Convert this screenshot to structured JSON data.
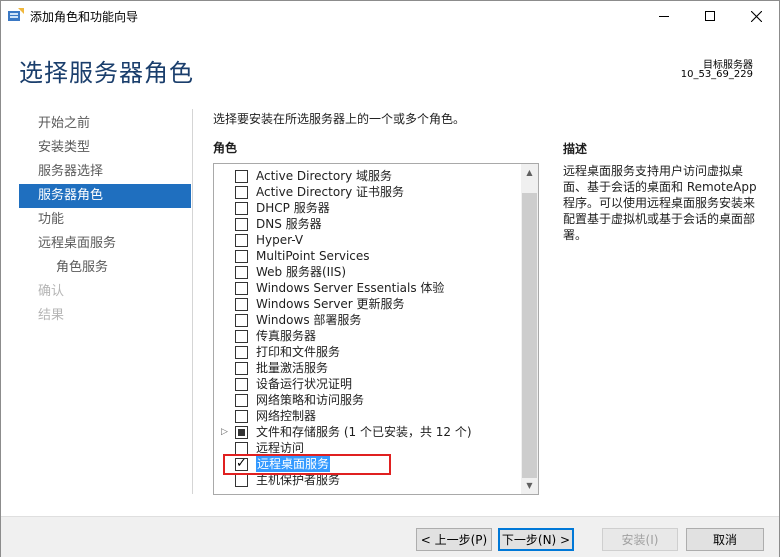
{
  "window": {
    "title": "添加角色和功能向导",
    "minimize_icon": "minimize-icon",
    "maximize_icon": "maximize-icon",
    "close_icon": "close-icon"
  },
  "header": {
    "page_title": "选择服务器角色",
    "target_label": "目标服务器",
    "target_value": "10_53_69_229"
  },
  "sidebar": {
    "items": [
      {
        "label": "开始之前",
        "state": "normal"
      },
      {
        "label": "安装类型",
        "state": "normal"
      },
      {
        "label": "服务器选择",
        "state": "normal"
      },
      {
        "label": "服务器角色",
        "state": "active"
      },
      {
        "label": "功能",
        "state": "normal"
      },
      {
        "label": "远程桌面服务",
        "state": "normal"
      },
      {
        "label": "角色服务",
        "state": "sub"
      },
      {
        "label": "确认",
        "state": "disabled"
      },
      {
        "label": "结果",
        "state": "disabled"
      }
    ]
  },
  "main": {
    "instruction": "选择要安装在所选服务器上的一个或多个角色。",
    "roles_heading": "角色",
    "roles": [
      {
        "label": "Active Directory 域服务",
        "checked": false
      },
      {
        "label": "Active Directory 证书服务",
        "checked": false
      },
      {
        "label": "DHCP 服务器",
        "checked": false
      },
      {
        "label": "DNS 服务器",
        "checked": false
      },
      {
        "label": "Hyper-V",
        "checked": false
      },
      {
        "label": "MultiPoint Services",
        "checked": false
      },
      {
        "label": "Web 服务器(IIS)",
        "checked": false
      },
      {
        "label": "Windows Server Essentials 体验",
        "checked": false
      },
      {
        "label": "Windows Server 更新服务",
        "checked": false
      },
      {
        "label": "Windows 部署服务",
        "checked": false
      },
      {
        "label": "传真服务器",
        "checked": false
      },
      {
        "label": "打印和文件服务",
        "checked": false
      },
      {
        "label": "批量激活服务",
        "checked": false
      },
      {
        "label": "设备运行状况证明",
        "checked": false
      },
      {
        "label": "网络策略和访问服务",
        "checked": false
      },
      {
        "label": "网络控制器",
        "checked": false
      },
      {
        "label": "文件和存储服务 (1 个已安装，共 12 个)",
        "checked": "partial",
        "expandable": true
      },
      {
        "label": "远程访问",
        "checked": false
      },
      {
        "label": "远程桌面服务",
        "checked": true,
        "selected": true
      },
      {
        "label": "主机保护者服务",
        "checked": false
      }
    ],
    "desc_heading": "描述",
    "desc_text": "远程桌面服务支持用户访问虚拟桌面、基于会话的桌面和 RemoteApp 程序。可以使用远程桌面服务安装来配置基于虚拟机或基于会话的桌面部署。"
  },
  "footer": {
    "prev_label": "< 上一步(P)",
    "next_label": "下一步(N) >",
    "install_label": "安装(I)",
    "cancel_label": "取消"
  },
  "colors": {
    "accent": "#1f6fbf",
    "title": "#1a3e6c",
    "selection": "#3399ff",
    "highlight_border": "#e02020"
  }
}
